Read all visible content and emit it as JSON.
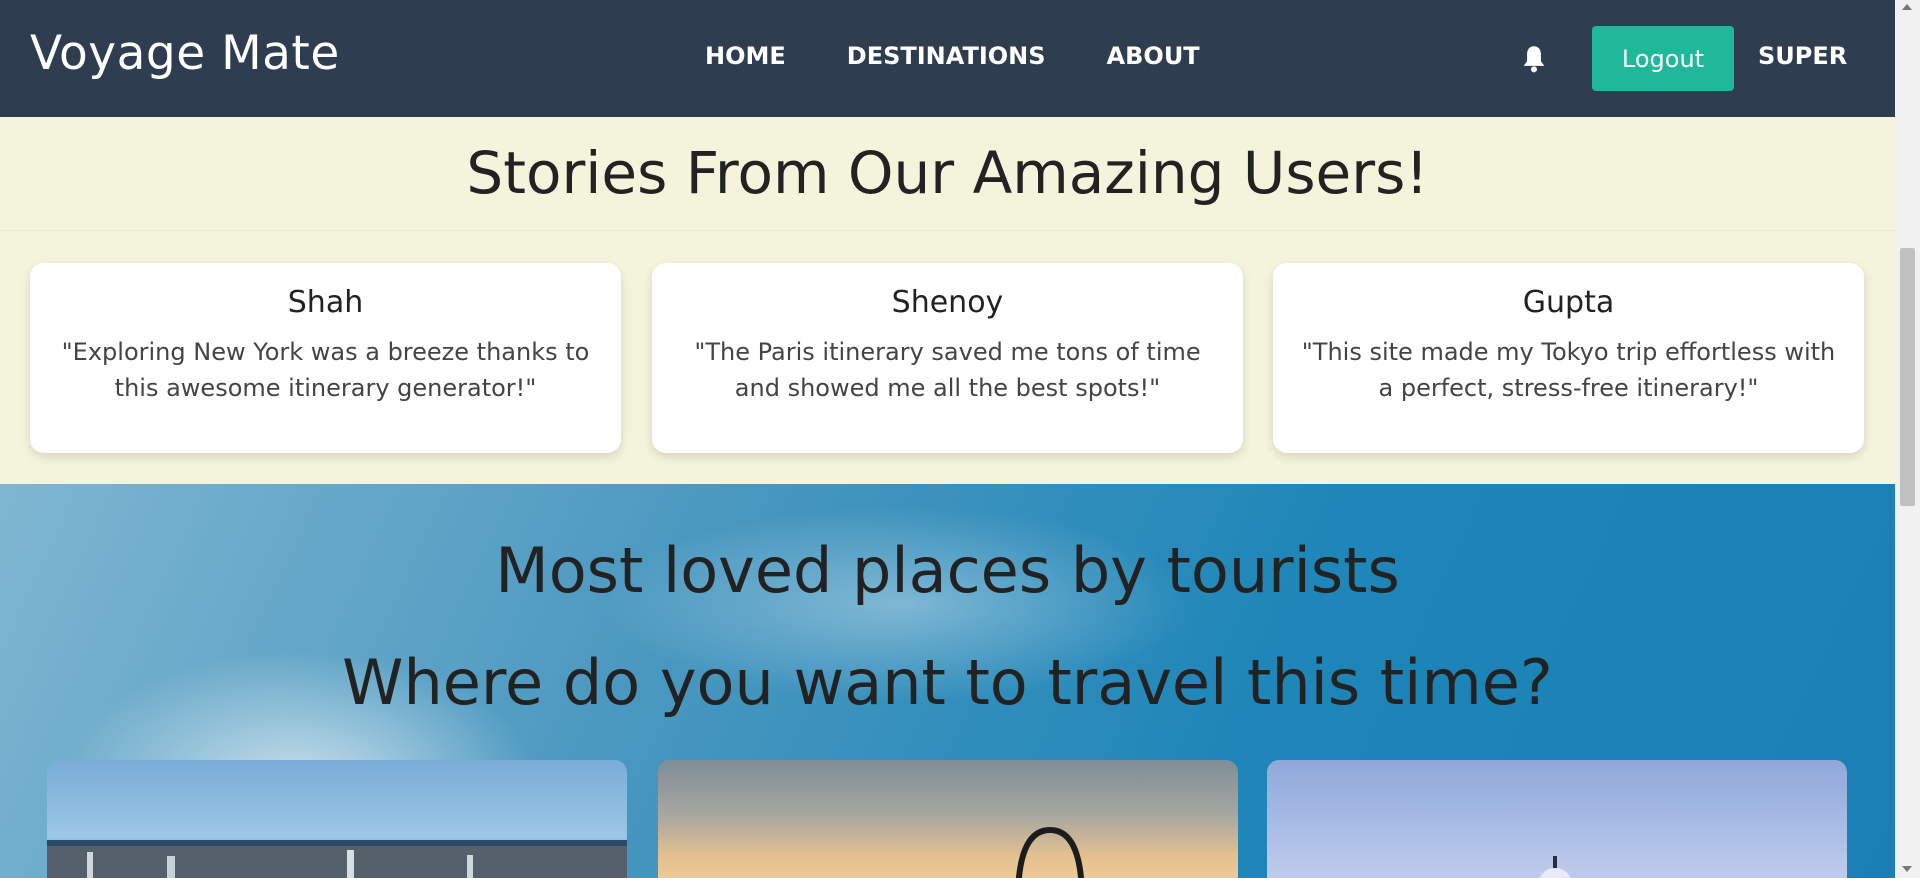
{
  "navbar": {
    "brand": "Voyage Mate",
    "links": [
      "HOME",
      "DESTINATIONS",
      "ABOUT"
    ],
    "logout_label": "Logout",
    "user_label": "SUPER",
    "bell_icon": "bell-icon"
  },
  "stories": {
    "title": "Stories From Our Amazing Users!",
    "cards": [
      {
        "name": "Shah",
        "quote": "\"Exploring New York was a breeze thanks to this awesome itinerary generator!\""
      },
      {
        "name": "Shenoy",
        "quote": "\"The Paris itinerary saved me tons of time and showed me all the best spots!\""
      },
      {
        "name": "Gupta",
        "quote": "\"This site made my Tokyo trip effortless with a perfect, stress-free itinerary!\""
      }
    ]
  },
  "places": {
    "title": "Most loved places by tourists",
    "subtitle": "Where do you want to travel this time?"
  },
  "colors": {
    "navbar_bg": "#2e3d50",
    "accent": "#1fb89a",
    "stories_bg": "#f4f4dc"
  }
}
